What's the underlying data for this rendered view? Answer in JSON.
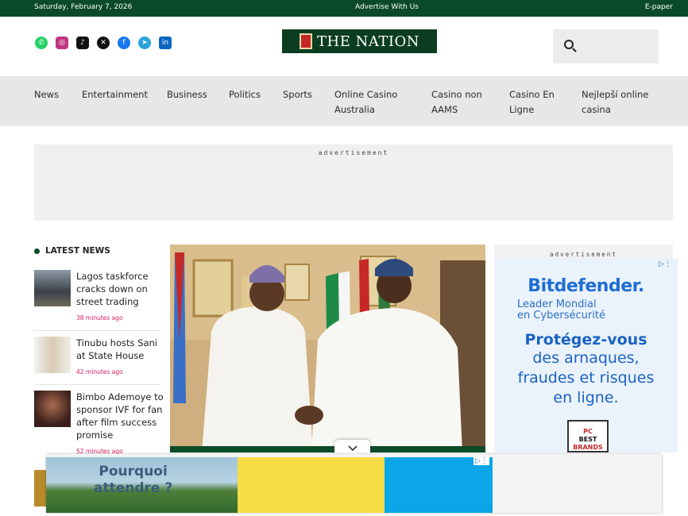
{
  "topbar": {
    "date": "Saturday, February 7, 2026",
    "advertise": "Advertise With Us",
    "epaper": "E-paper"
  },
  "header": {
    "logo_text": "THE NATION",
    "social_icons": [
      "whatsapp-icon",
      "instagram-icon",
      "tiktok-icon",
      "x-icon",
      "facebook-icon",
      "telegram-icon",
      "linkedin-icon"
    ],
    "search_placeholder": ""
  },
  "nav": {
    "items": [
      {
        "label": "News"
      },
      {
        "label": "Entertainment"
      },
      {
        "label": "Business"
      },
      {
        "label": "Politics"
      },
      {
        "label": "Sports"
      },
      {
        "label": "Online Casino Australia"
      },
      {
        "label": "Casino non AAMS"
      },
      {
        "label": "Casino En Ligne"
      },
      {
        "label": "Nejlepší online casina"
      }
    ]
  },
  "ads": {
    "top_label": "advertisement",
    "side_label": "advertisement"
  },
  "latest": {
    "heading": "LATEST NEWS",
    "items": [
      {
        "title": "Lagos taskforce cracks down on street trading",
        "time": "38 minutes ago"
      },
      {
        "title": "Tinubu hosts Sani at State House",
        "time": "42 minutes ago"
      },
      {
        "title": "Bimbo Ademoye to sponsor IVF for fan after film success promise",
        "time": "52 minutes ago"
      }
    ]
  },
  "side_ad": {
    "brand": "Bitdefender.",
    "sub1": "Leader Mondial",
    "sub2": "en Cybersécurité",
    "headline": "Protégez-vous",
    "line2": "des arnaques,",
    "line3": "fraudes et risques",
    "line4": "en ligne.",
    "badge_top": "PC",
    "badge_mid": "BEST",
    "badge_bot": "BRANDS"
  },
  "sticky_ad": {
    "line1": "Pourquoi",
    "line2": "attendre ?"
  },
  "colors": {
    "brand_green": "#0b4a28",
    "nav_bg": "#e6e8e6",
    "time_pink": "#d81b60",
    "bitdefender_blue": "#1f6ed4"
  }
}
